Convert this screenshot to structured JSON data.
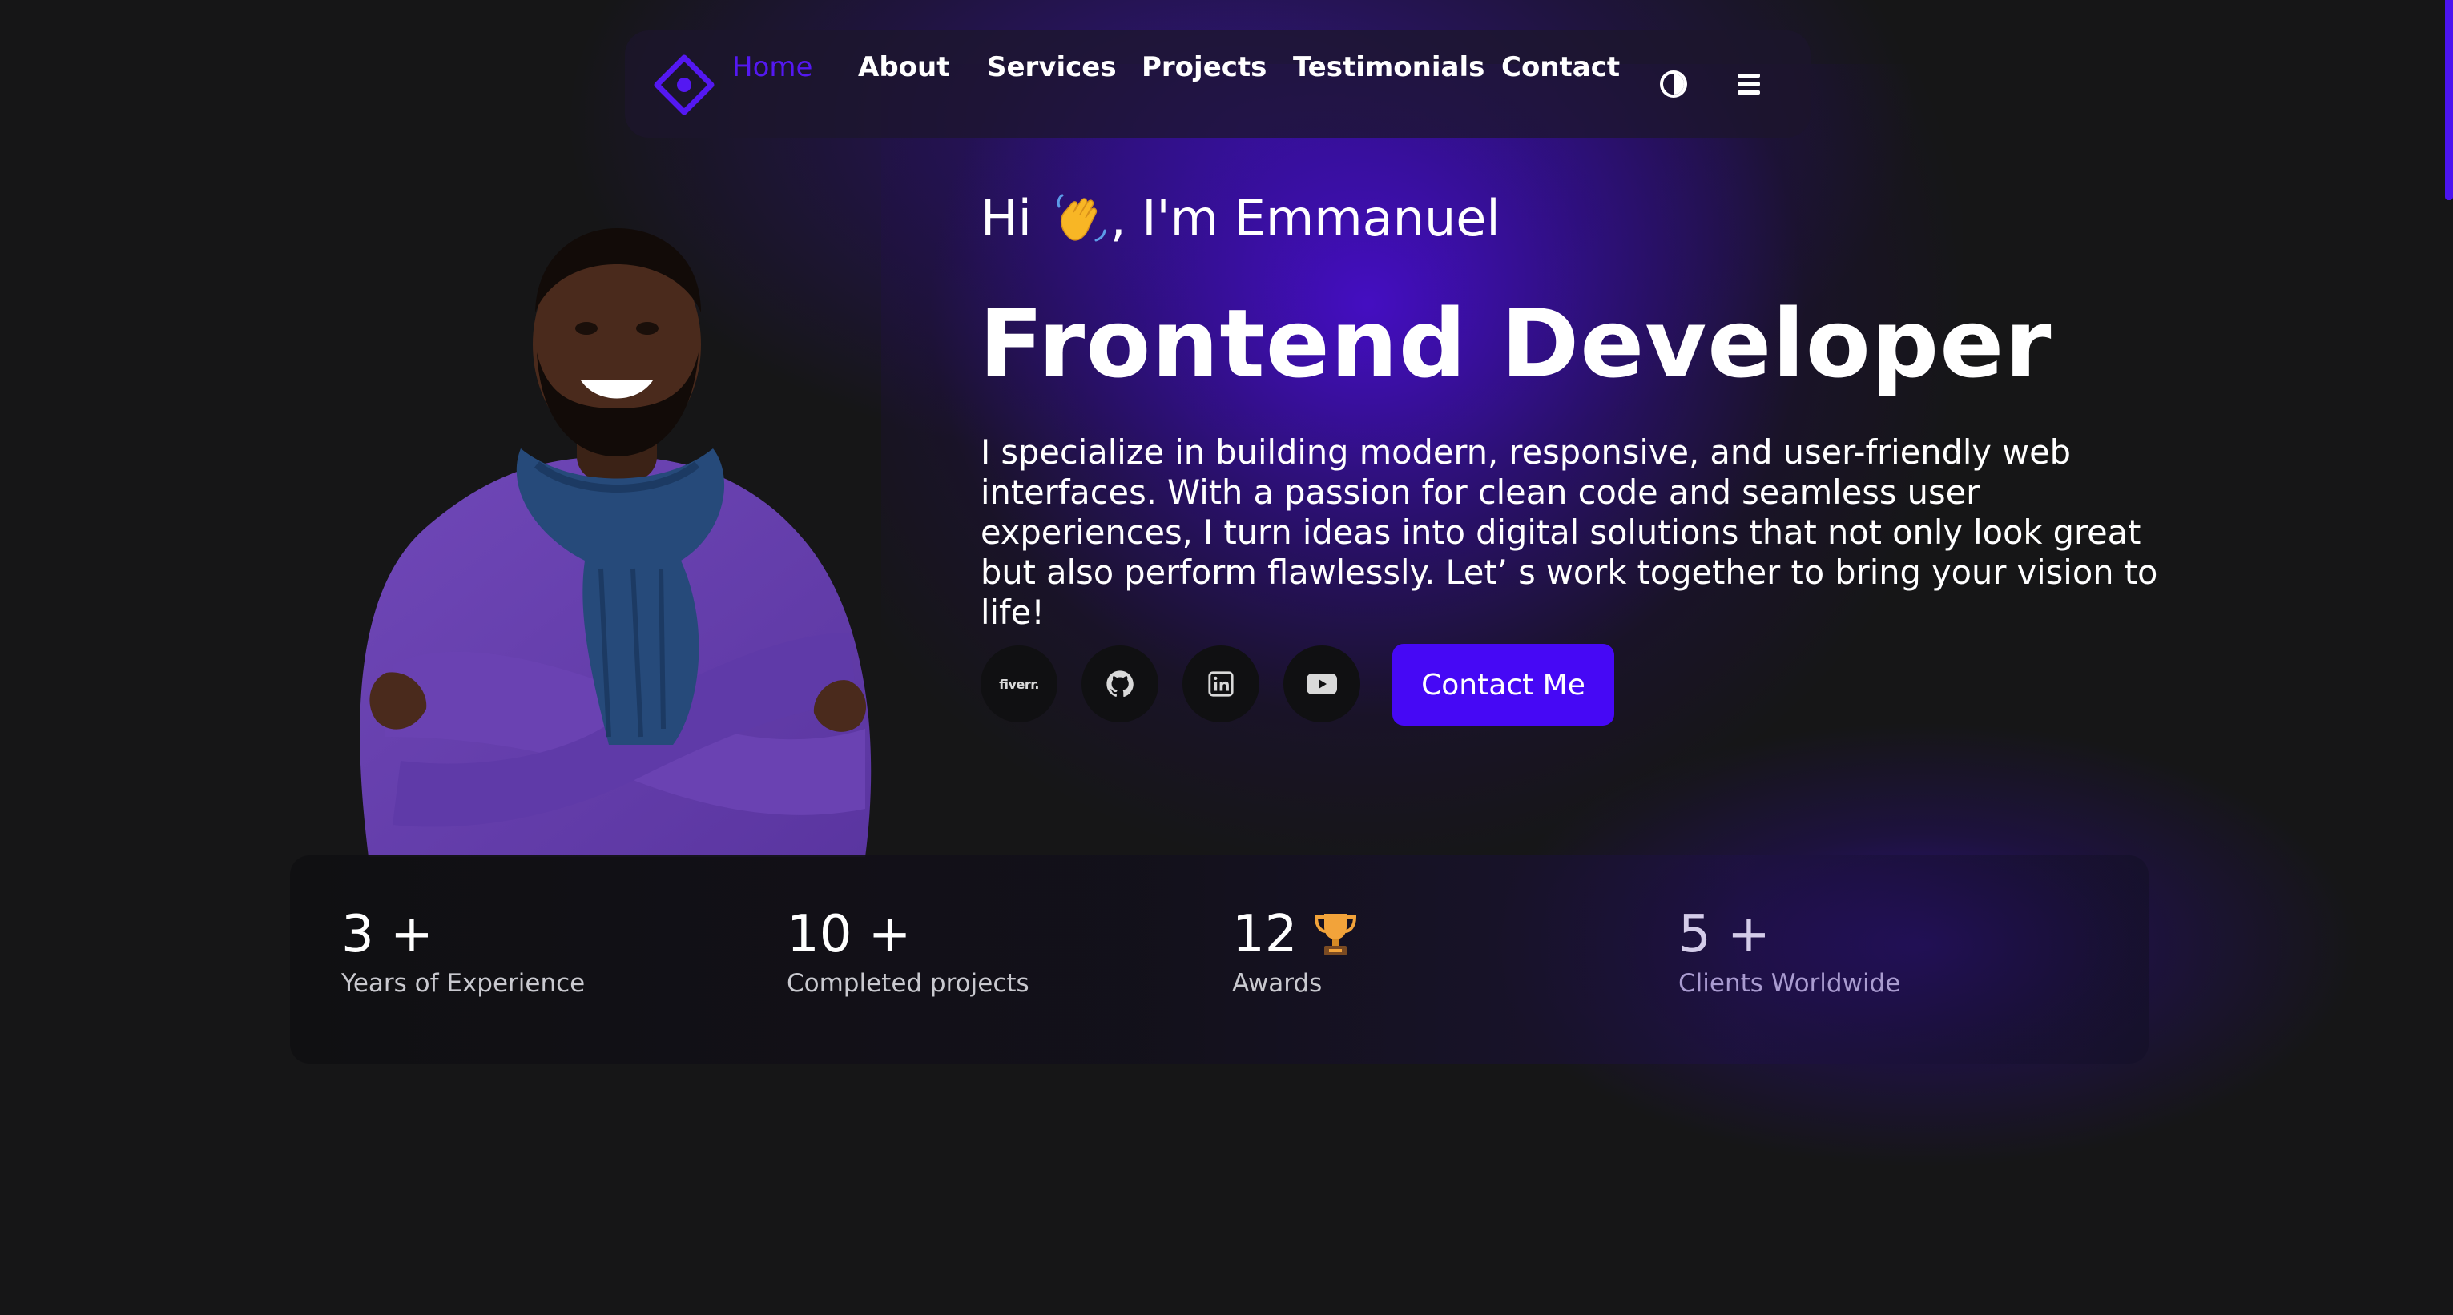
{
  "nav": {
    "items": [
      {
        "label": "Home",
        "active": true
      },
      {
        "label": "About"
      },
      {
        "label": "Services"
      },
      {
        "label": "Projects"
      },
      {
        "label": "Testimonials"
      },
      {
        "label": "Contact"
      }
    ],
    "icons": [
      "logo-icon",
      "theme-toggle-icon",
      "menu-icon"
    ]
  },
  "hero": {
    "greeting_prefix": "Hi",
    "greeting_suffix": ", I'm Emmanuel",
    "title": "Frontend Developer",
    "description": "I specialize in building modern, responsive, and user-friendly web interfaces. With a passion for clean code and seamless user experiences, I turn ideas into digital solutions that not only look great but also perform flawlessly. Let’ s work together to bring your vision to life!",
    "socials": [
      {
        "name": "fiverr",
        "label": "fiverr."
      },
      {
        "name": "github-icon"
      },
      {
        "name": "linkedin-icon"
      },
      {
        "name": "youtube-icon"
      }
    ],
    "contact_button": "Contact Me"
  },
  "stats": [
    {
      "value": "3 +",
      "label": "Years of Experience"
    },
    {
      "value": "10 +",
      "label": "Completed projects"
    },
    {
      "value": "12",
      "label": "Awards",
      "icon": "trophy-icon"
    },
    {
      "value": "5 +",
      "label": "Clients Worldwide"
    }
  ],
  "colors": {
    "background": "#161617",
    "accent": "#4608f5",
    "active_nav": "#5418f2",
    "nav_background": "#1c162c"
  }
}
